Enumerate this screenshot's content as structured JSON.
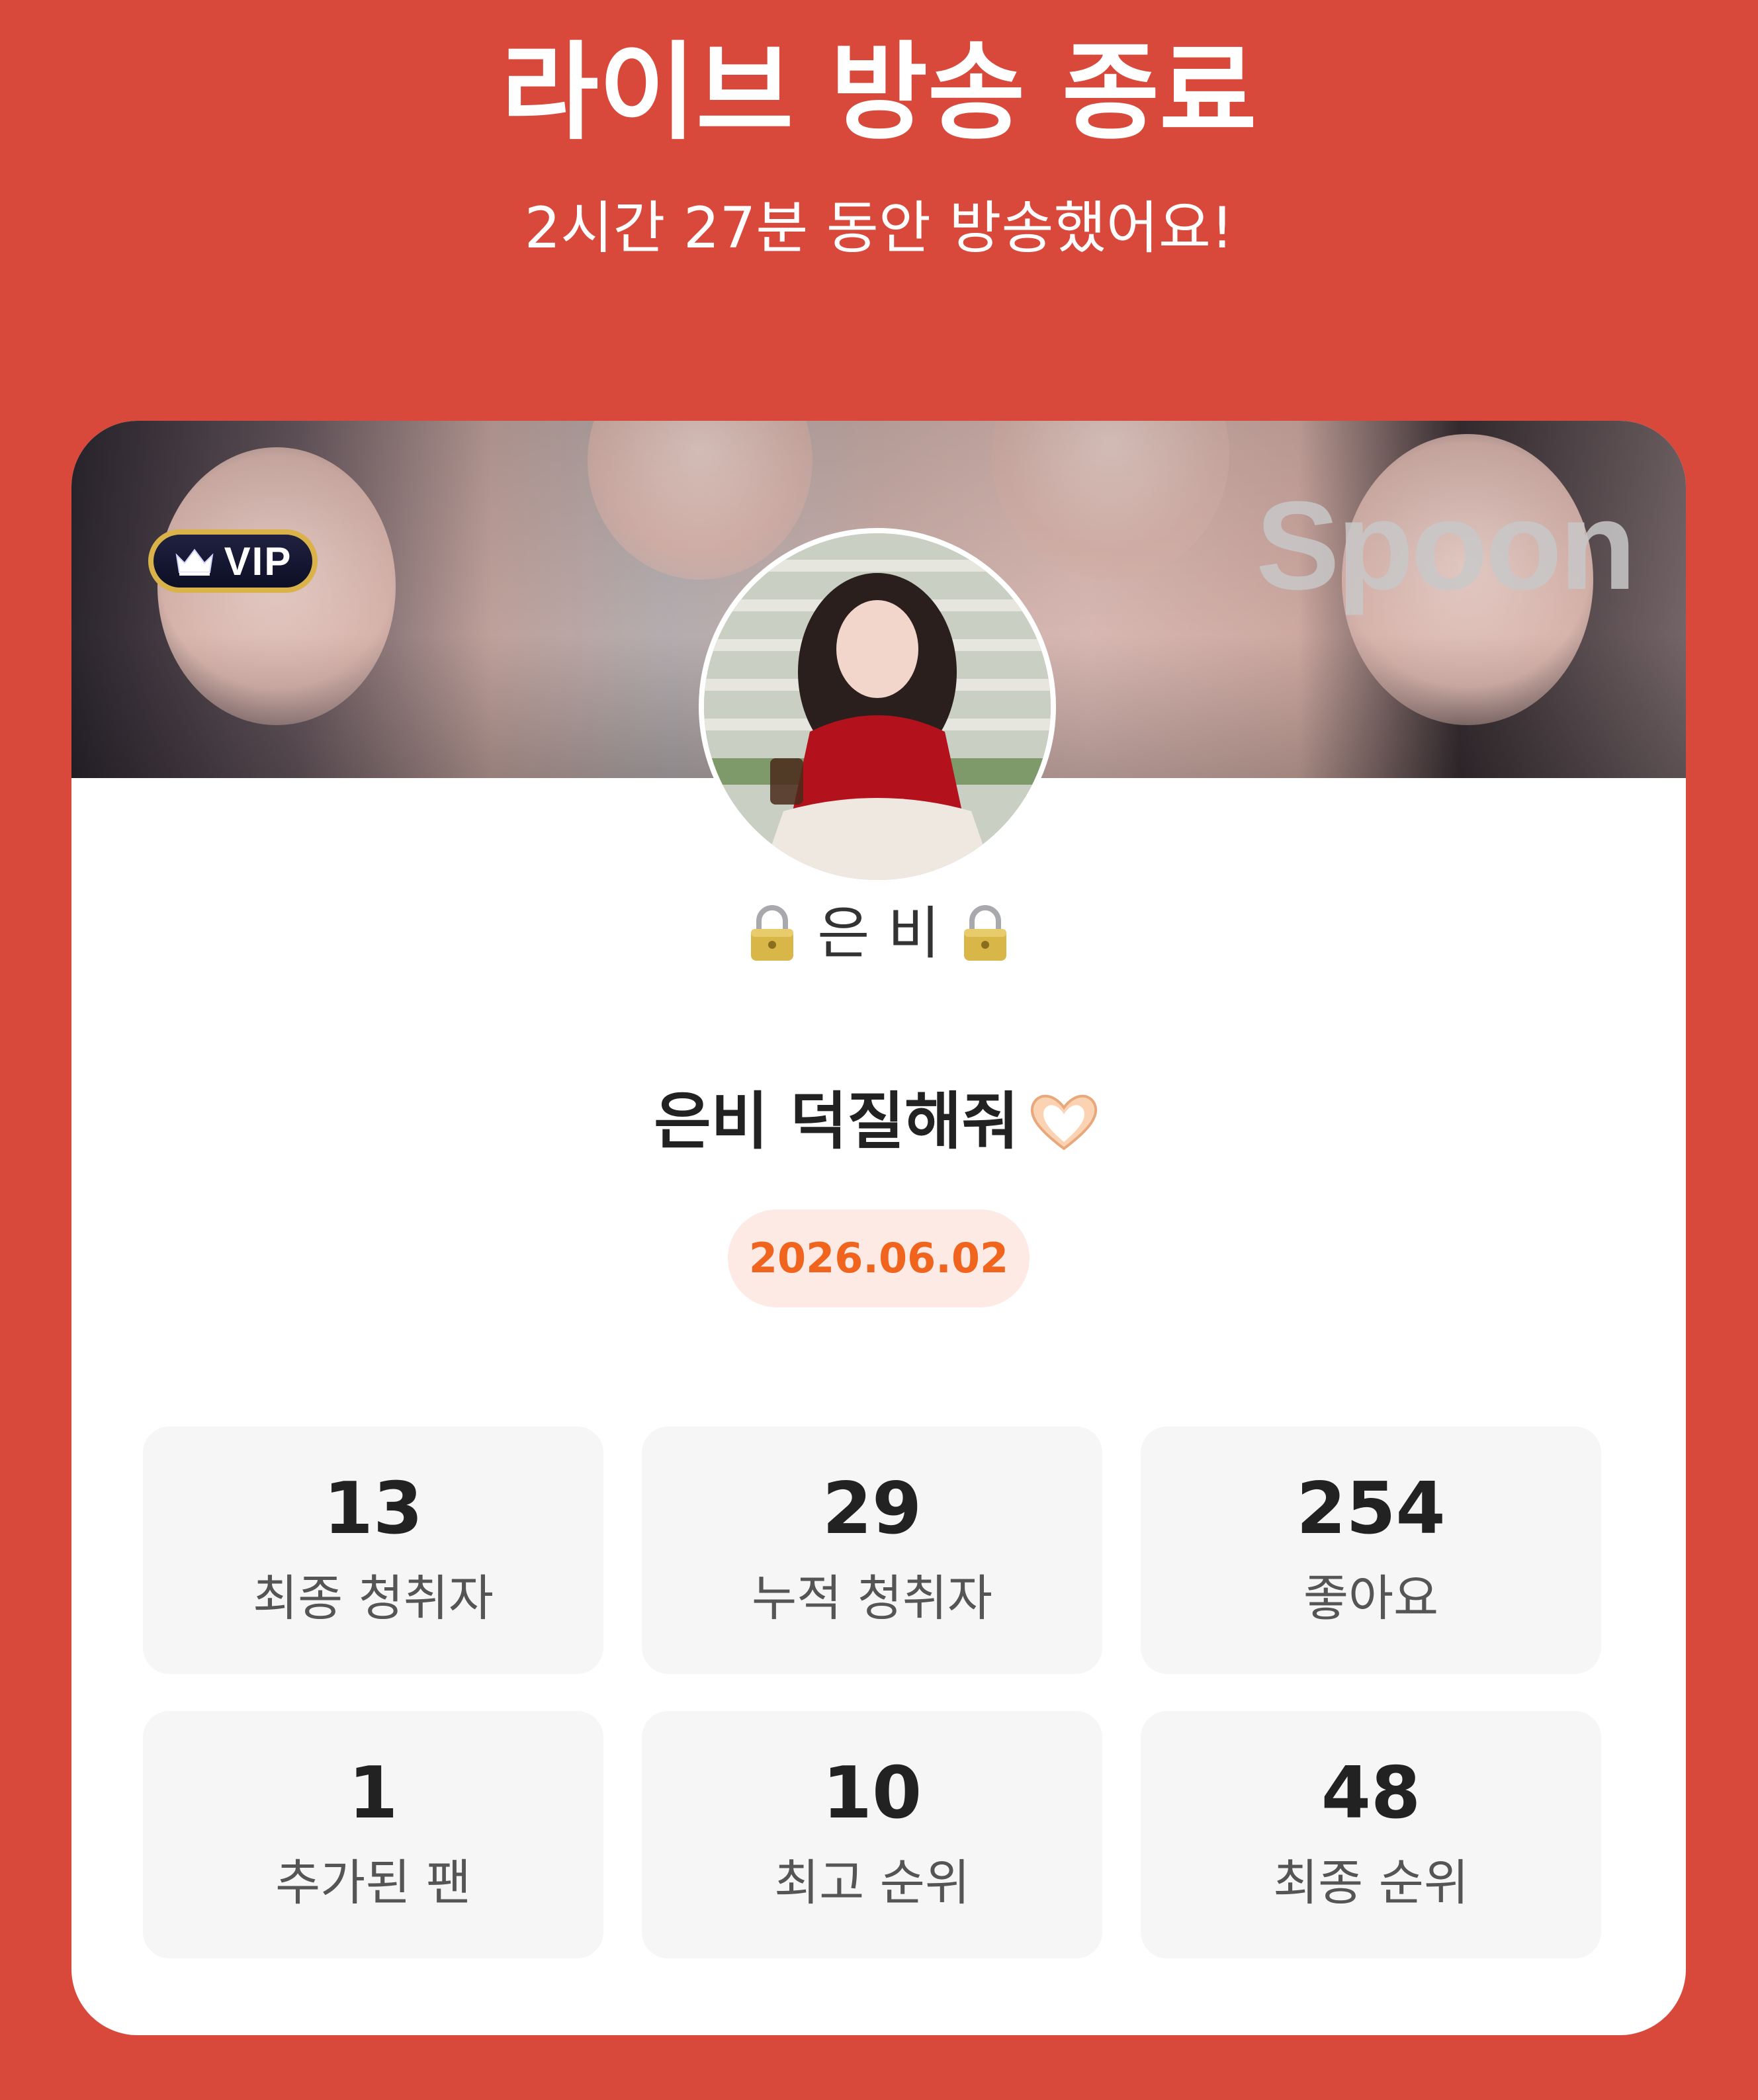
{
  "header": {
    "title": "라이브 방송 종료",
    "subtitle": "2시간 27분 동안 방송했어요!"
  },
  "banner": {
    "vip_label": "VIP",
    "logo_text": "Spoon"
  },
  "profile": {
    "nickname": "은 비",
    "nickname_icons": [
      "lock-icon",
      "lock-icon"
    ]
  },
  "broadcast": {
    "title": "은비 덕질해줘",
    "title_icon": "heart-hands-icon",
    "date": "2026.06.02"
  },
  "stats": [
    {
      "value": "13",
      "label": "최종 청취자"
    },
    {
      "value": "29",
      "label": "누적 청취자"
    },
    {
      "value": "254",
      "label": "좋아요"
    },
    {
      "value": "1",
      "label": "추가된 팬"
    },
    {
      "value": "10",
      "label": "최고 순위"
    },
    {
      "value": "48",
      "label": "최종 순위"
    }
  ],
  "colors": {
    "background": "#d9493b",
    "card": "#ffffff",
    "date_text": "#f0641e",
    "date_bg": "#fdeae4",
    "stat_bg": "#f6f6f6"
  }
}
